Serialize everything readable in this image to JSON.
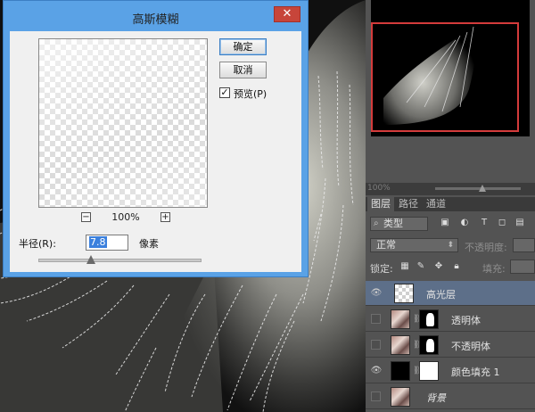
{
  "dialog": {
    "title": "高斯模糊",
    "close_glyph": "✕",
    "ok_label": "确定",
    "cancel_label": "取消",
    "preview_check_glyph": "✓",
    "preview_label": "预览(P)",
    "zoom_out_glyph": "−",
    "zoom_in_glyph": "+",
    "zoom_level": "100%",
    "radius_label": "半径(R):",
    "radius_value": "7.8",
    "unit_label": "像素",
    "radius_slider_fraction": 0.32
  },
  "navigator": {
    "zoom": "100%",
    "zoom_slider_fraction": 0.55,
    "view_box_color": "#d43b3b"
  },
  "layers_panel": {
    "tabs": [
      "图层",
      "路径",
      "通道"
    ],
    "kind_filter_icon": "search-icon",
    "kind_filter": "类型",
    "filter_icons": [
      "image-icon",
      "adjustment-icon",
      "type-icon",
      "shape-icon",
      "smart-object-icon"
    ],
    "blend_mode": "正常",
    "opacity_label": "不透明度:",
    "lock_label": "锁定:",
    "fill_label": "填充:",
    "layers": [
      {
        "name": "高光层",
        "visible": true,
        "selected": true
      },
      {
        "name": "透明体",
        "visible": false,
        "selected": false
      },
      {
        "name": "不透明体",
        "visible": false,
        "selected": false
      },
      {
        "name": "颜色填充 1",
        "visible": true,
        "selected": false
      },
      {
        "name": "背景",
        "visible": false,
        "selected": false,
        "italic": true
      }
    ]
  },
  "colors": {
    "dialog_frame": "#5aa2e6",
    "close_button": "#c7453a",
    "selected_layer": "#5d6f89",
    "selection_field": "#3b80dd"
  }
}
